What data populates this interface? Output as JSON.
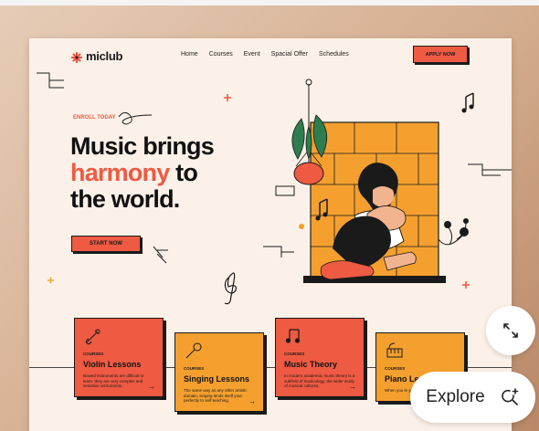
{
  "nav": {
    "logo_text": "miclub",
    "links": [
      "Home",
      "Courses",
      "Event",
      "Spacial Offer",
      "Schedules"
    ],
    "apply_label": "APPLY NOW"
  },
  "hero": {
    "enroll_label": "ENROLL TODAY",
    "title_line1": "Music brings",
    "title_accent": "harmony",
    "title_line2_rest": " to",
    "title_line3": "the world.",
    "start_label": "START NOW"
  },
  "courses": [
    {
      "tag": "COURSES",
      "title": "Violin Lessons",
      "desc": "Bowed instruments are difficult to learn. they are very complex and sensitive instruments.",
      "color": "red",
      "icon": "violin-icon"
    },
    {
      "tag": "COURSES",
      "title": "Singing Lessons",
      "desc": "The same way as any other artistic domain, singing lends itself your perfectly to self-teaching.",
      "color": "orange",
      "icon": "microphone-icon"
    },
    {
      "tag": "COURSES",
      "title": "Music Theory",
      "desc": "In modern academia, music theory is a subfield of musicology, the wider study of musical cultures.",
      "color": "red",
      "icon": "music-notes-icon"
    },
    {
      "tag": "COURSES",
      "title": "Piano Le",
      "desc": "When you le you get in guide you sta",
      "color": "orange",
      "icon": "piano-icon"
    }
  ],
  "overlay": {
    "explore_label": "Explore"
  },
  "colors": {
    "accent": "#ef5a43",
    "orange": "#f5a02e",
    "background": "#fbf1e8",
    "ink": "#1a1a1a"
  }
}
